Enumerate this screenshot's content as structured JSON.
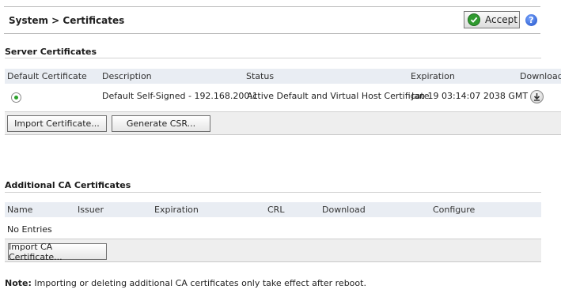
{
  "header": {
    "breadcrumb": "System > Certificates",
    "accept_label": "Accept",
    "help_label": "?"
  },
  "server_certificates": {
    "title": "Server Certificates",
    "columns": [
      "Default Certificate",
      "Description",
      "Status",
      "Expiration",
      "Download"
    ],
    "rows": [
      {
        "default_selected": true,
        "description": "Default Self-Signed - 192.168.200.1",
        "status": "Active Default and Virtual Host Certificate",
        "expiration": "Jan 19 03:14:07 2038 GMT",
        "download_icon": "download-icon"
      }
    ],
    "buttons": {
      "import": "Import Certificate...",
      "generate_csr": "Generate CSR..."
    }
  },
  "ca_certificates": {
    "title": "Additional CA Certificates",
    "columns": [
      "Name",
      "Issuer",
      "Expiration",
      "CRL",
      "Download",
      "Configure"
    ],
    "empty_text": "No Entries",
    "buttons": {
      "import_ca": "Import CA Certificate..."
    }
  },
  "note": {
    "label": "Note:",
    "text": " Importing or deleting additional CA certificates only take effect after reboot."
  },
  "colors": {
    "accept_icon": "#2f9a2f",
    "radio_selected": "#2aa12a",
    "header_row_bg": "#e9edf3",
    "button_bar_bg": "#eeeeee"
  }
}
